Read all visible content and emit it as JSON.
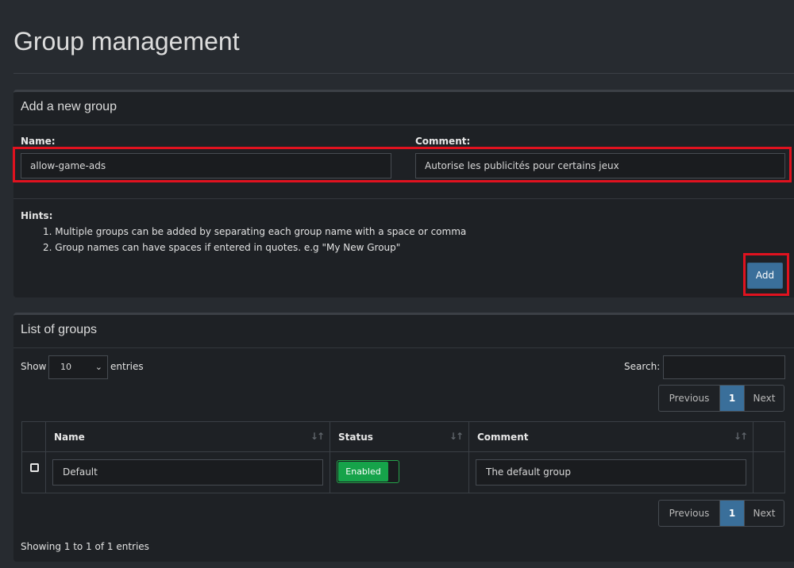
{
  "page": {
    "title": "Group management"
  },
  "add_group": {
    "header": "Add a new group",
    "name_label": "Name:",
    "name_value": "allow-game-ads",
    "comment_label": "Comment:",
    "comment_value": "Autorise les publicités pour certains jeux",
    "hints_label": "Hints:",
    "hints": [
      "1. Multiple groups can be added by separating each group name with a space or comma",
      "2. Group names can have spaces if entered in quotes. e.g \"My New Group\""
    ],
    "add_button": "Add"
  },
  "list": {
    "header": "List of groups",
    "show_label": "Show",
    "entries_value": "10",
    "entries_label": "entries",
    "search_label": "Search:",
    "pager": {
      "previous": "Previous",
      "current": "1",
      "next": "Next"
    },
    "columns": [
      "Name",
      "Status",
      "Comment"
    ],
    "rows": [
      {
        "name": "Default",
        "status": "Enabled",
        "comment": "The default group"
      }
    ],
    "footer": "Showing 1 to 1 of 1 entries"
  },
  "colors": {
    "accent": "#3a6f9a",
    "enabled": "#16a34a",
    "highlight": "#e0121f"
  }
}
